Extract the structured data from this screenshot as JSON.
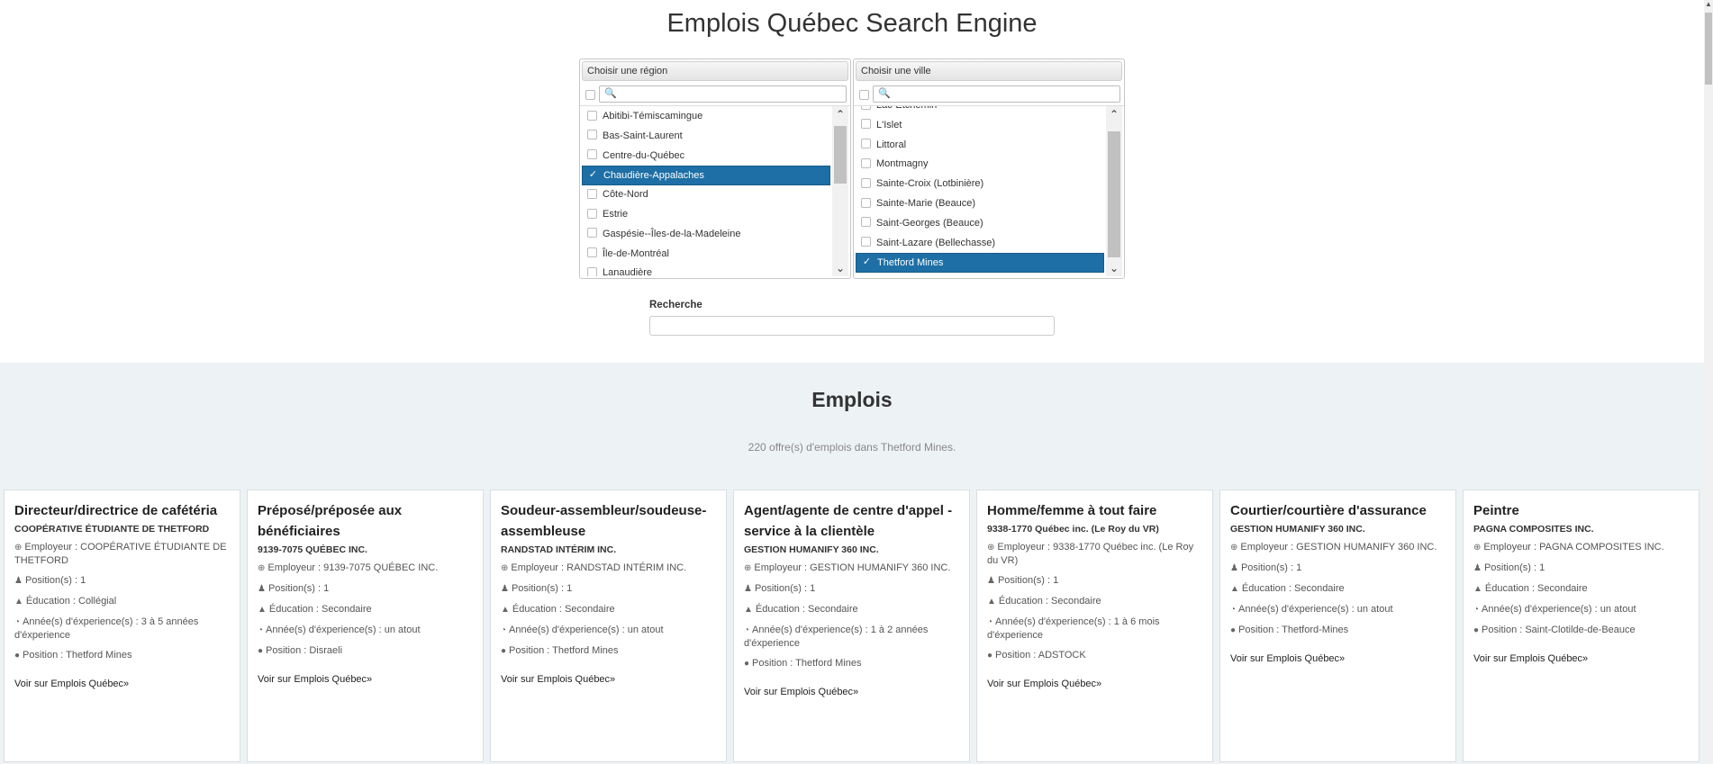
{
  "page": {
    "title": "Emplois Québec Search Engine"
  },
  "region_select": {
    "header": "Choisir une région",
    "items": [
      {
        "label": "Abitibi-Témiscamingue",
        "selected": false
      },
      {
        "label": "Bas-Saint-Laurent",
        "selected": false
      },
      {
        "label": "Centre-du-Québec",
        "selected": false
      },
      {
        "label": "Chaudière-Appalaches",
        "selected": true
      },
      {
        "label": "Côte-Nord",
        "selected": false
      },
      {
        "label": "Estrie",
        "selected": false
      },
      {
        "label": "Gaspésie--Îles-de-la-Madeleine",
        "selected": false
      },
      {
        "label": "Île-de-Montréal",
        "selected": false
      },
      {
        "label": "Lanaudière",
        "selected": false
      }
    ]
  },
  "city_select": {
    "header": "Choisir une ville",
    "items": [
      {
        "label": "Lac-Etchemin",
        "selected": false
      },
      {
        "label": "L'Islet",
        "selected": false
      },
      {
        "label": "Littoral",
        "selected": false
      },
      {
        "label": "Montmagny",
        "selected": false
      },
      {
        "label": "Sainte-Croix (Lotbinière)",
        "selected": false
      },
      {
        "label": "Sainte-Marie (Beauce)",
        "selected": false
      },
      {
        "label": "Saint-Georges (Beauce)",
        "selected": false
      },
      {
        "label": "Saint-Lazare (Bellechasse)",
        "selected": false
      },
      {
        "label": "Thetford Mines",
        "selected": true
      }
    ]
  },
  "search": {
    "label": "Recherche",
    "value": ""
  },
  "jobs": {
    "title": "Emplois",
    "count_text": "220 offre(s) d'emplois dans Thetford Mines.",
    "cards": [
      {
        "title": "Directeur/directrice de cafétéria",
        "company": "COOPÉRATIVE ÉTUDIANTE DE THETFORD",
        "employer": "Employeur : COOPÉRATIVE ÉTUDIANTE DE THETFORD",
        "positions": "Position(s) : 1",
        "education": "Éducation : Collégial",
        "experience": "Année(s) d'éxperience(s) : 3 à 5 années d'éxperience",
        "location": "Position : Thetford Mines",
        "link": "Voir sur Emplois Québec»"
      },
      {
        "title": "Préposé/préposée aux bénéficiaires",
        "company": "9139-7075 QUÉBEC INC.",
        "employer": "Employeur : 9139-7075 QUÉBEC INC.",
        "positions": "Position(s) : 1",
        "education": "Éducation : Secondaire",
        "experience": "Année(s) d'éxperience(s) : un atout",
        "location": "Position : Disraeli",
        "link": "Voir sur Emplois Québec»"
      },
      {
        "title": "Soudeur-assembleur/soudeuse-assembleuse",
        "company": "RANDSTAD INTÉRIM INC.",
        "employer": "Employeur : RANDSTAD INTÉRIM INC.",
        "positions": "Position(s) : 1",
        "education": "Éducation : Secondaire",
        "experience": "Année(s) d'éxperience(s) : un atout",
        "location": "Position : Thetford Mines",
        "link": "Voir sur Emplois Québec»"
      },
      {
        "title": "Agent/agente de centre d'appel - service à la clientèle",
        "company": "GESTION HUMANIFY 360 INC.",
        "employer": "Employeur : GESTION HUMANIFY 360 INC.",
        "positions": "Position(s) : 1",
        "education": "Éducation : Secondaire",
        "experience": "Année(s) d'éxperience(s) : 1 à 2 années d'éxperience",
        "location": "Position : Thetford Mines",
        "link": "Voir sur Emplois Québec»"
      },
      {
        "title": "Homme/femme à tout faire",
        "company": "9338-1770 Québec inc. (Le Roy du VR)",
        "employer": "Employeur : 9338-1770 Québec inc. (Le Roy du VR)",
        "positions": "Position(s) : 1",
        "education": "Éducation : Secondaire",
        "experience": "Année(s) d'éxperience(s) : 1 à 6 mois d'éxperience",
        "location": "Position : ADSTOCK",
        "link": "Voir sur Emplois Québec»"
      },
      {
        "title": "Courtier/courtière d'assurance",
        "company": "GESTION HUMANIFY 360 INC.",
        "employer": "Employeur : GESTION HUMANIFY 360 INC.",
        "positions": "Position(s) : 1",
        "education": "Éducation : Secondaire",
        "experience": "Année(s) d'éxperience(s) : un atout",
        "location": "Position : Thetford-Mines",
        "link": "Voir sur Emplois Québec»"
      },
      {
        "title": "Peintre",
        "company": "PAGNA COMPOSITES INC.",
        "employer": "Employeur : PAGNA COMPOSITES INC.",
        "positions": "Position(s) : 1",
        "education": "Éducation : Secondaire",
        "experience": "Année(s) d'éxperience(s) : un atout",
        "location": "Position : Saint-Clotilde-de-Beauce",
        "link": "Voir sur Emplois Québec»"
      }
    ]
  },
  "colors": {
    "selected_bg": "#1d6fa5",
    "section_bg": "#edf2f5"
  }
}
